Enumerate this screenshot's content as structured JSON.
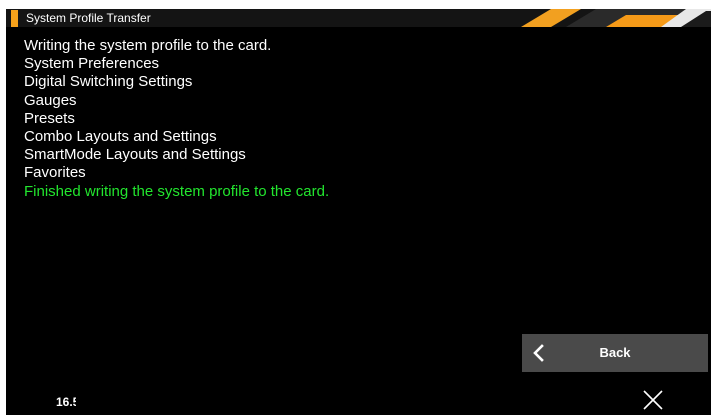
{
  "window": {
    "title": "System Profile Transfer",
    "accent_color": "#f7a21b"
  },
  "log": {
    "lines": [
      "Writing the system profile to the card.",
      "System Preferences",
      "Digital Switching Settings",
      "Gauges",
      "Presets",
      "Combo Layouts and Settings",
      "SmartMode Layouts and Settings",
      "Favorites"
    ],
    "success_line": "Finished writing the system profile to the card.",
    "success_color": "#22e52e"
  },
  "footer": {
    "readout": "16.5",
    "back_label": "Back",
    "back_icon": "chevron-left-icon",
    "close_icon": "close-icon"
  }
}
